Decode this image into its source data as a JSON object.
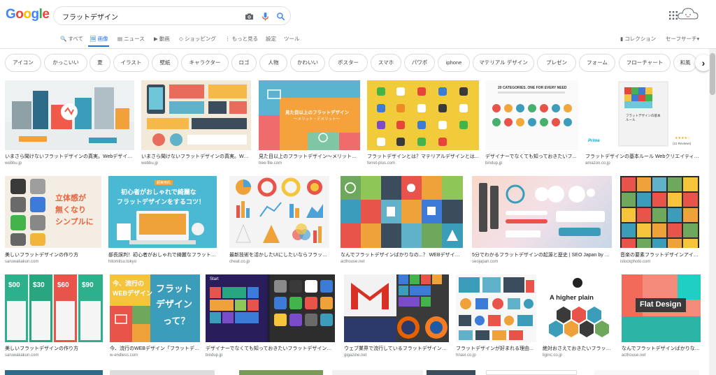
{
  "colors": {
    "blue": "#4285f4",
    "red": "#ea4335",
    "yellow": "#fbbc05",
    "green": "#34a853",
    "active": "#1a73e8"
  },
  "logo": {
    "letters": [
      "G",
      "o",
      "o",
      "g",
      "l",
      "e"
    ]
  },
  "search": {
    "query": "フラットデザイン",
    "icons": [
      "camera-icon",
      "microphone-icon",
      "search-icon"
    ]
  },
  "nav": {
    "items": [
      "すべて",
      "画像",
      "ニュース",
      "動画",
      "ショッピング",
      "もっと見る",
      "設定",
      "ツール"
    ],
    "icons": [
      "search-icon",
      "image-icon",
      "news-icon",
      "video-icon",
      "tag-icon",
      "more-icon",
      "",
      ""
    ],
    "right": [
      "コレクション",
      "セーフサーチ▾"
    ]
  },
  "chips": [
    "アイコン",
    "かっこいい",
    "夏",
    "イラスト",
    "壁紙",
    "キャラクター",
    "ロゴ",
    "人物",
    "かわいい",
    "ポスター",
    "スマホ",
    "パワポ",
    "iphone",
    "マテリアル デザイン",
    "プレゼン",
    "フォーム",
    "フローチャート",
    "和風"
  ],
  "chips_arrow": "›",
  "results": [
    {
      "caption": "いまさら聞けないフラットデザインの真実。Webデザインは...",
      "source": "webbu.jp"
    },
    {
      "caption": "いまさら聞けないフラットデザインの真実。Web...",
      "source": "webbu.jp"
    },
    {
      "caption": "見た目以上のフラットデザイン〜メリットとデ...",
      "source": "tree-file.com"
    },
    {
      "caption": "フラットデザインとは？マテリアルデザインとは...",
      "source": "ferret-plus.com"
    },
    {
      "caption": "デザイナーでなくても知っておきたいフ...",
      "source": "bindup.jp"
    },
    {
      "caption": "フラットデザインの基本ルール Webクリエイティブ&...",
      "source": "amazon.co.jp"
    },
    {
      "caption": "美しいフラットデザインの作り方",
      "source": "saruwakakun.com"
    },
    {
      "caption": "部長誤判！初心者がおしゃれで綺麗なフラットデ...",
      "source": "hitomitsu.tokyo"
    },
    {
      "caption": "最新技術を活かしたUIにしたいならフラットデ...",
      "source": "cheat.co.jp"
    },
    {
      "caption": "なんでフラットデザインばかりなの...？ WEBデザインは...",
      "source": "acthouse.net"
    },
    {
      "caption": "5分でわかるフラットデザインの起源と歴史 | SEO Japan by アイ...",
      "source": "seojapan.com"
    },
    {
      "caption": "音楽の要素フラットデザインアイコ...",
      "source": "istockphoto.com"
    },
    {
      "caption": "美しいフラットデザインの作り方",
      "source": "saruwakakun.com"
    },
    {
      "caption": "今、流行のWEBデザイン「フラットデザ...",
      "source": "w-endless.com"
    },
    {
      "caption": "デザイナーでなくても知っておきたいフラットデザインのこ...",
      "source": "bindup.jp"
    },
    {
      "caption": "ウェブ業界で流行しているフラットデザインの...",
      "source": "gigazine.net"
    },
    {
      "caption": "フラットデザインが好まれる理由...",
      "source": "hnavi.co.jp"
    },
    {
      "caption": "絶対おさえておきたいフラット...",
      "source": "liginc.co.jp"
    },
    {
      "caption": "なんでフラットデザインばかりなんな...",
      "source": "acthouse.net"
    }
  ],
  "image_text": {
    "r3": "見た目以上のフラットデザイン",
    "r3b": "〜メリット・デメリット〜",
    "r5": "20 CATEGORIES. ONE FOR EVERY NEED",
    "r6a": "Prime",
    "r6b": "(21 Reviews)",
    "r6c": "フラットデザインの基本ルール",
    "r7a": "立体感が",
    "r7b": "無くなり",
    "r7c": "シンプルに",
    "r8a": "超実用的",
    "r8b": "初心者がおしゃれで綺麗な",
    "r8c": "フラットデザインをするコツ！",
    "r13": [
      "$00",
      "$30",
      "$60",
      "$90"
    ],
    "r14a": "今、流行の",
    "r14b": "WEBデザイン",
    "r14c": "フラット",
    "r14d": "デザイン",
    "r14e": "って？",
    "r15": "Start",
    "r18": "A higher plain",
    "r19": "Flat Design"
  }
}
